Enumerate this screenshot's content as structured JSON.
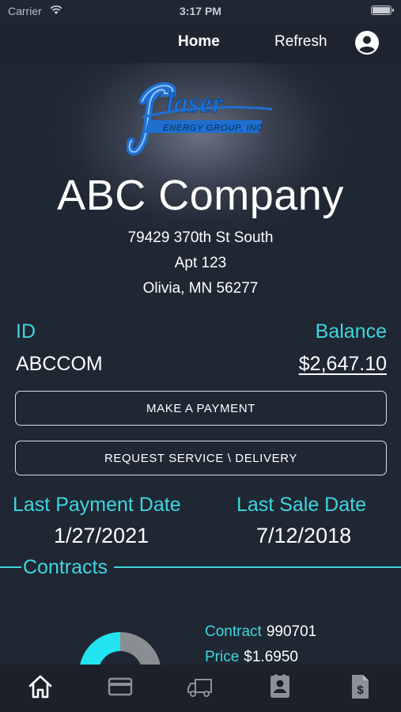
{
  "status_bar": {
    "carrier": "Carrier",
    "time": "3:17 PM",
    "wifi_icon": "wifi-icon",
    "battery_icon": "battery-icon"
  },
  "nav": {
    "home_label": "Home",
    "refresh_label": "Refresh",
    "profile_icon": "profile-icon"
  },
  "logo": {
    "brand": "Glaser",
    "tagline": "ENERGY GROUP, INC",
    "color": "#1e6fd0"
  },
  "customer": {
    "company_name": "ABC Company",
    "address_line1": "79429 370th St South",
    "address_line2": "Apt 123",
    "address_line3": "Olivia, MN 56277"
  },
  "account": {
    "id_label": "ID",
    "id_value": "ABCCOM",
    "balance_label": "Balance",
    "balance_value": "$2,647.10"
  },
  "actions": {
    "make_payment_label": "MAKE A PAYMENT",
    "request_service_label": "REQUEST SERVICE \\ DELIVERY"
  },
  "dates": {
    "last_payment_label": "Last Payment Date",
    "last_payment_value": "1/27/2021",
    "last_sale_label": "Last Sale Date",
    "last_sale_value": "7/12/2018"
  },
  "contracts": {
    "section_label": "Contracts",
    "contract_label": "Contract",
    "contract_value": "990701",
    "price_label": "Price",
    "price_value": "$1.6950",
    "gauge_fill_fraction": 0.5
  },
  "tabs": [
    {
      "name": "home",
      "icon": "home-icon",
      "active": true
    },
    {
      "name": "payments",
      "icon": "credit-card-icon",
      "active": false
    },
    {
      "name": "delivery",
      "icon": "truck-icon",
      "active": false
    },
    {
      "name": "contact",
      "icon": "contact-card-icon",
      "active": false
    },
    {
      "name": "invoices",
      "icon": "invoice-icon",
      "active": false
    }
  ],
  "colors": {
    "accent": "#3ed6df",
    "background": "#1f2733",
    "gauge_filled": "#22e4f0",
    "gauge_empty": "#8a8d92"
  }
}
